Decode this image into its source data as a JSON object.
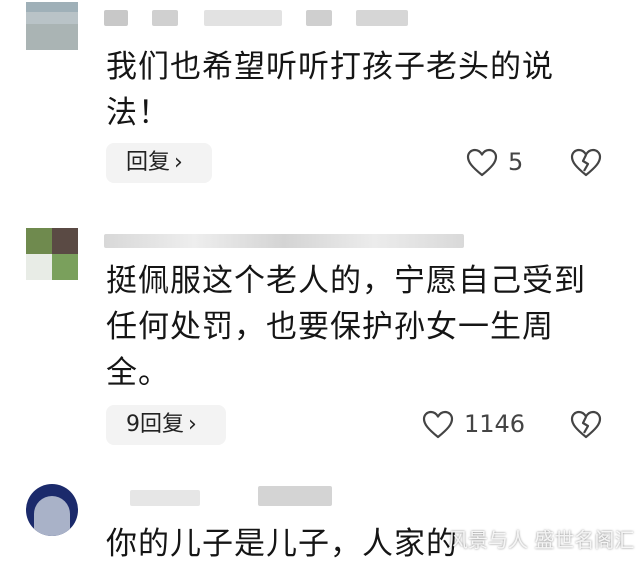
{
  "comments": [
    {
      "text": "我们也希望听听打孩子老头的说法！",
      "reply_label": "回复",
      "like_count": "5"
    },
    {
      "text": "挺佩服这个老人的，宁愿自己受到任何处罚，也要保护孙女一生周全。",
      "reply_label": "9回复",
      "like_count": "1146"
    },
    {
      "text": "你的儿子是儿子，人家的"
    }
  ],
  "icons": {
    "chevron": "›",
    "like": "heart-outline-icon",
    "dislike": "broken-heart-icon"
  },
  "watermark": "风景与人 盛世名阁汇"
}
